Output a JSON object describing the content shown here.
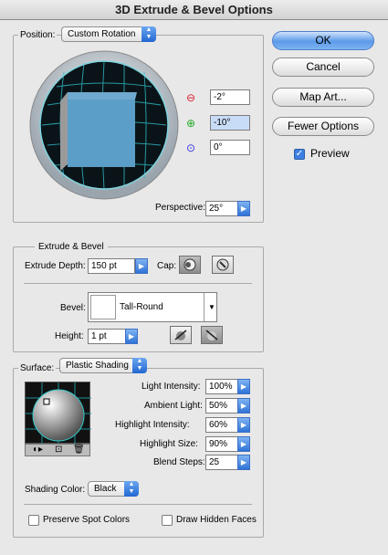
{
  "window": {
    "title": "3D Extrude & Bevel Options"
  },
  "buttons": {
    "ok": "OK",
    "cancel": "Cancel",
    "map_art": "Map Art...",
    "fewer_options": "Fewer Options"
  },
  "preview": {
    "label": "Preview",
    "checked": true
  },
  "position": {
    "label": "Position:",
    "value": "Custom Rotation",
    "rotation_x": "-2°",
    "rotation_y": "-10°",
    "rotation_z": "0°",
    "perspective_label": "Perspective:",
    "perspective_value": "25°"
  },
  "extrude_bevel": {
    "section_label": "Extrude & Bevel",
    "depth_label": "Extrude Depth:",
    "depth_value": "150 pt",
    "cap_label": "Cap:",
    "bevel_label": "Bevel:",
    "bevel_value": "Tall-Round",
    "height_label": "Height:",
    "height_value": "1 pt"
  },
  "surface": {
    "label": "Surface:",
    "value": "Plastic Shading",
    "light_intensity_label": "Light Intensity:",
    "light_intensity_value": "100%",
    "ambient_light_label": "Ambient Light:",
    "ambient_light_value": "50%",
    "highlight_intensity_label": "Highlight Intensity:",
    "highlight_intensity_value": "60%",
    "highlight_size_label": "Highlight Size:",
    "highlight_size_value": "90%",
    "blend_steps_label": "Blend Steps:",
    "blend_steps_value": "25",
    "shading_color_label": "Shading Color:",
    "shading_color_value": "Black",
    "preserve_spot_label": "Preserve Spot Colors",
    "draw_hidden_label": "Draw Hidden Faces"
  },
  "colors": {
    "accent": "#3b7ddd",
    "cube_face": "#5b9ec7",
    "grid": "#33c9c9"
  }
}
